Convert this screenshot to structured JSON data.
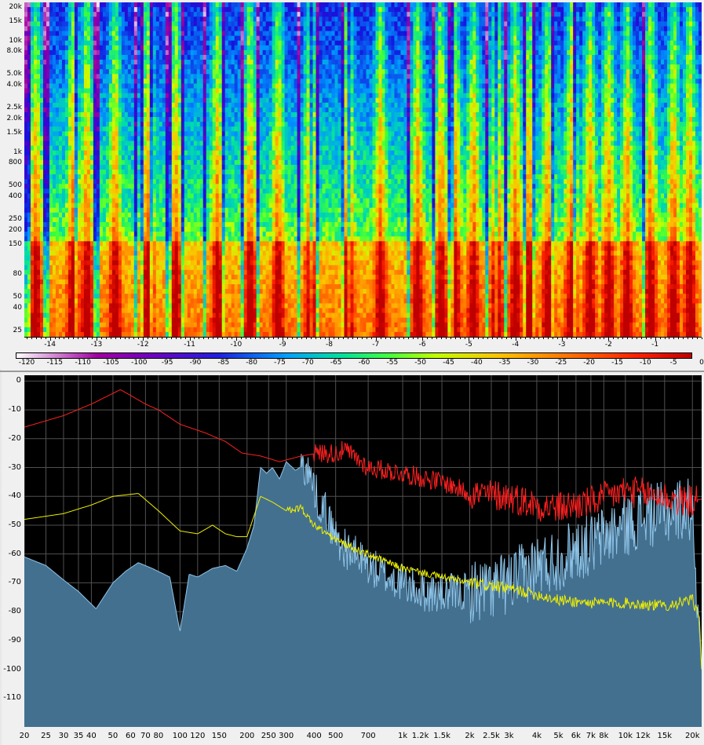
{
  "colors": {
    "spectrum_fill": "#44708f",
    "spectrum_edge": "#8ec4e8",
    "peak_line": "#ff2020",
    "average_line": "#f0f000",
    "grid": "#505050",
    "background": "#000000"
  },
  "chart_data": [
    {
      "type": "heatmap",
      "name": "spectrogram",
      "x_ticks": [
        "-14",
        "-13",
        "-12",
        "-11",
        "-10",
        "-9",
        "-8",
        "-7",
        "-6",
        "-5",
        "-4",
        "-3",
        "-2",
        "-1"
      ],
      "x_tick_values": [
        -14,
        -13,
        -12,
        -11,
        -10,
        -9,
        -8,
        -7,
        -6,
        -5,
        -4,
        -3,
        -2,
        -1
      ],
      "xlim": [
        -14.55,
        0
      ],
      "y_scale": "log",
      "ylim": [
        22,
        22000
      ],
      "y_ticks": [
        "20k",
        "15k",
        "10k",
        "8.0k",
        "5.0k",
        "4.0k",
        "2.5k",
        "2.0k",
        "1.5k",
        "1k",
        "800",
        "500",
        "400",
        "250",
        "200",
        "150",
        "80",
        "50",
        "40",
        "25"
      ],
      "y_tick_values": [
        20000,
        15000,
        10000,
        8000,
        5000,
        4000,
        2500,
        2000,
        1500,
        1000,
        800,
        500,
        400,
        250,
        200,
        150,
        80,
        50,
        40,
        25
      ],
      "colorbar_ticks": [
        "-120",
        "-115",
        "-110",
        "-105",
        "-100",
        "-95",
        "-90",
        "-85",
        "-80",
        "-75",
        "-70",
        "-65",
        "-60",
        "-55",
        "-50",
        "-45",
        "-40",
        "-35",
        "-30",
        "-25",
        "-20",
        "-15",
        "-10",
        "-5",
        "0"
      ],
      "colorbar_range": [
        -120,
        0
      ]
    },
    {
      "type": "area",
      "name": "fft-spectrum",
      "x_scale": "log",
      "xlim": [
        20,
        22000
      ],
      "ylim": [
        -120,
        2
      ],
      "grid": true,
      "x_ticks": [
        "20",
        "25",
        "30",
        "35",
        "40",
        "50",
        "60",
        "70",
        "80",
        "100",
        "120",
        "150",
        "200",
        "250",
        "300",
        "400",
        "500",
        "700",
        "1k",
        "1.2k",
        "1.5k",
        "2k",
        "2.5k",
        "3k",
        "4k",
        "5k",
        "6k",
        "7k",
        "8k",
        "10k",
        "12k",
        "15k",
        "20k"
      ],
      "x_tick_values": [
        20,
        25,
        30,
        35,
        40,
        50,
        60,
        70,
        80,
        100,
        120,
        150,
        200,
        250,
        300,
        400,
        500,
        700,
        1000,
        1200,
        1500,
        2000,
        2500,
        3000,
        4000,
        5000,
        6000,
        7000,
        8000,
        10000,
        12000,
        15000,
        20000
      ],
      "y_ticks": [
        "0",
        "-10",
        "-20",
        "-30",
        "-40",
        "-50",
        "-60",
        "-70",
        "-80",
        "-90",
        "-100",
        "-110"
      ],
      "y_tick_values": [
        0,
        -10,
        -20,
        -30,
        -40,
        -50,
        -60,
        -70,
        -80,
        -90,
        -100,
        -110
      ],
      "series": [
        {
          "role": "current",
          "x": [
            20,
            25,
            30,
            35,
            42,
            50,
            57,
            65,
            75,
            90,
            100,
            110,
            120,
            140,
            160,
            180,
            200,
            215,
            230,
            245,
            260,
            280,
            300,
            330,
            360,
            390,
            420,
            450,
            480,
            510,
            550,
            600,
            700,
            800,
            1000,
            1200,
            1500,
            2000,
            2500,
            3000,
            4000,
            5000,
            6000,
            7000,
            8000,
            10000,
            12000,
            15000,
            18000,
            20000,
            22000
          ],
          "y": [
            -61,
            -64,
            -69,
            -73,
            -79,
            -70,
            -66,
            -63,
            -65,
            -68,
            -87,
            -67,
            -68,
            -65,
            -64,
            -66,
            -58,
            -50,
            -30,
            -32,
            -30,
            -34,
            -28,
            -31,
            -29,
            -34,
            -42,
            -45,
            -51,
            -55,
            -58,
            -60,
            -64,
            -67,
            -70,
            -73,
            -74,
            -73,
            -72,
            -70,
            -64,
            -62,
            -58,
            -57,
            -54,
            -50,
            -47,
            -46,
            -44,
            -45,
            -100
          ]
        },
        {
          "role": "peak",
          "x": [
            20,
            30,
            40,
            54,
            60,
            70,
            80,
            100,
            130,
            160,
            190,
            230,
            280,
            350,
            420,
            500,
            550,
            600,
            700,
            1000,
            1500,
            2000,
            3000,
            4000,
            5000,
            7000,
            10000,
            12000,
            15000,
            18000,
            22000
          ],
          "y": [
            -16,
            -12,
            -8,
            -3,
            -5,
            -8,
            -10,
            -15,
            -18,
            -21,
            -25,
            -26,
            -28,
            -26,
            -25,
            -25,
            -24,
            -26,
            -30,
            -32,
            -35,
            -39,
            -40,
            -43,
            -44,
            -42,
            -38,
            -39,
            -40,
            -42,
            -41
          ]
        },
        {
          "role": "average",
          "x": [
            20,
            30,
            40,
            50,
            65,
            80,
            100,
            120,
            140,
            160,
            180,
            200,
            230,
            260,
            300,
            350,
            400,
            500,
            600,
            800,
            1000,
            1500,
            2000,
            3000,
            4000,
            5000,
            7000,
            10000,
            15000,
            20000,
            21500,
            22000
          ],
          "y": [
            -48,
            -46,
            -43,
            -40,
            -39,
            -45,
            -52,
            -53,
            -50,
            -53,
            -54,
            -54,
            -40,
            -42,
            -45,
            -44,
            -50,
            -55,
            -58,
            -62,
            -65,
            -68,
            -70,
            -72,
            -74,
            -76,
            -77,
            -77,
            -78,
            -76,
            -82,
            -100
          ]
        }
      ]
    }
  ]
}
